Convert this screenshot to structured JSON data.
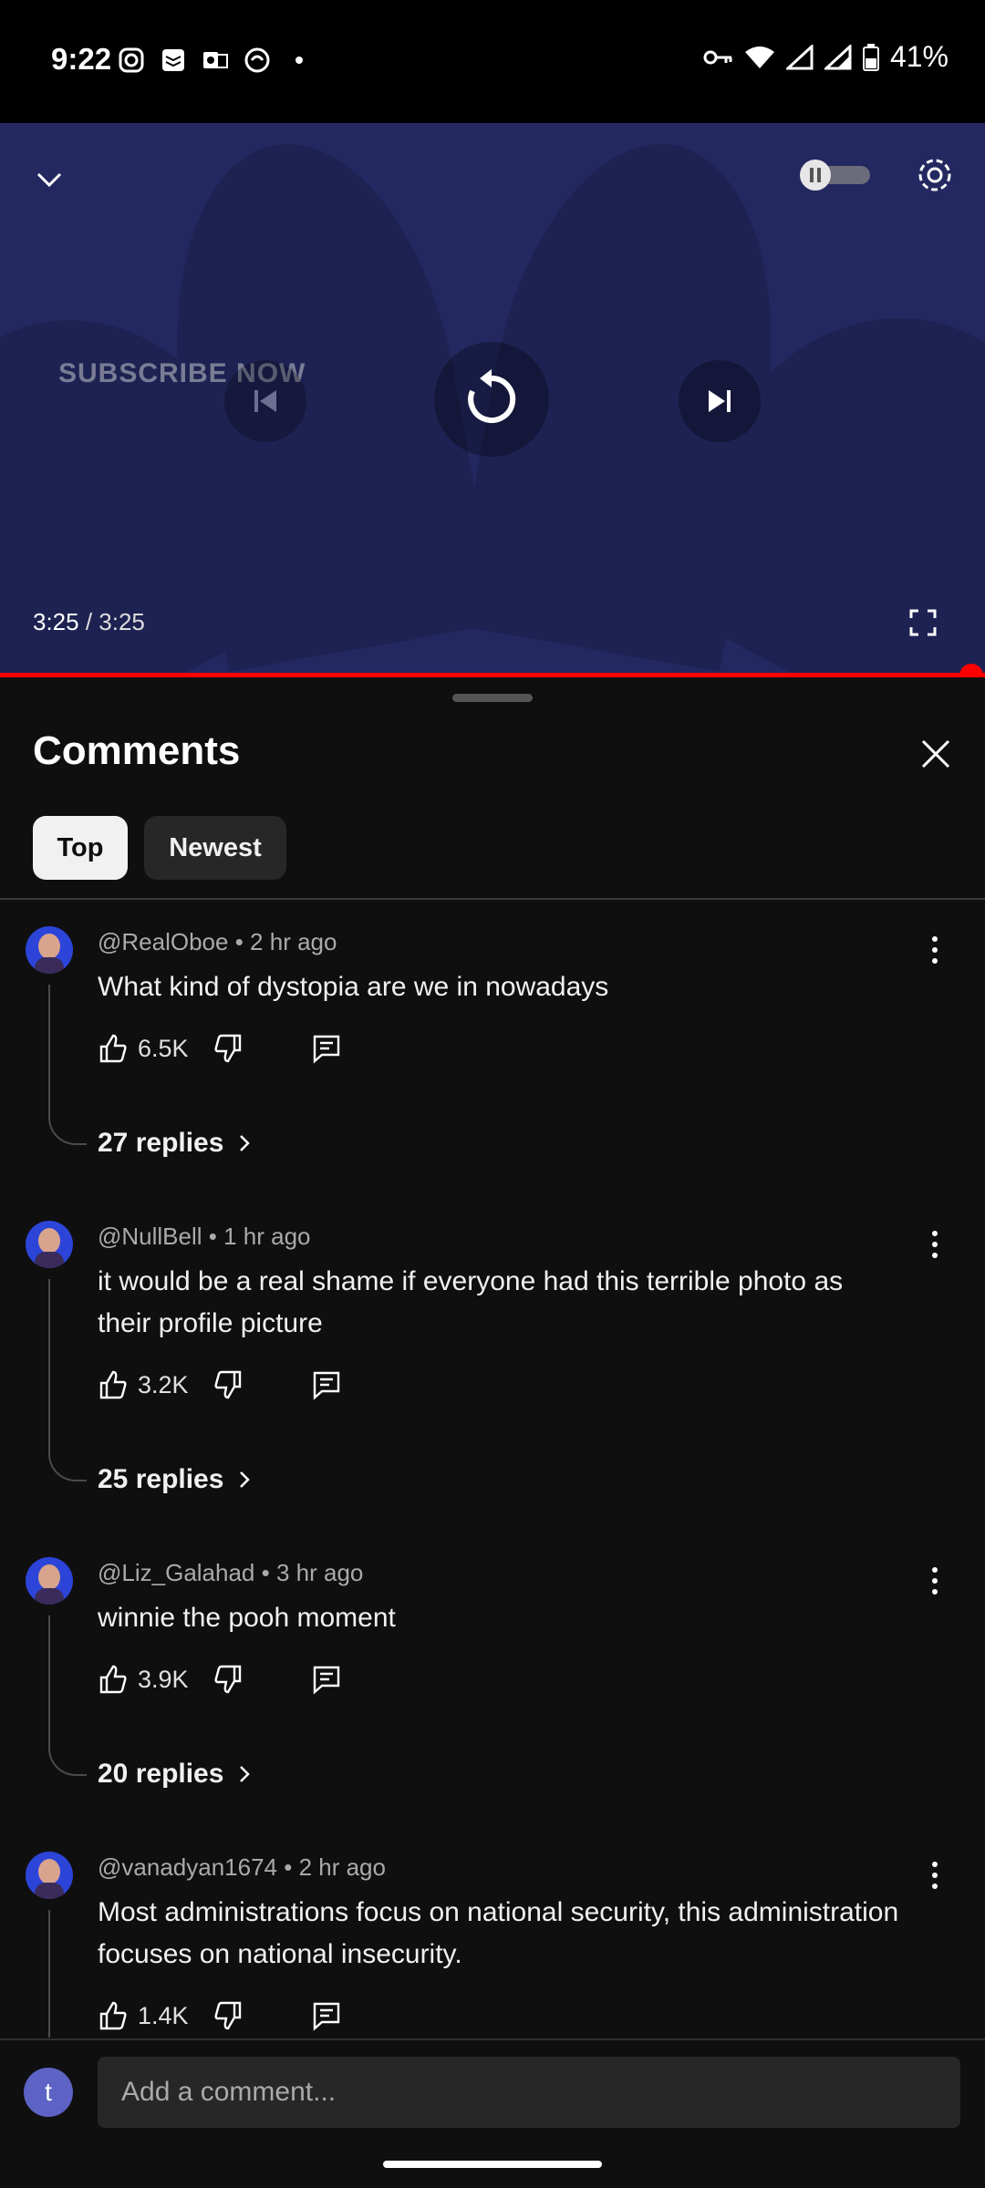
{
  "status_bar": {
    "time": "9:22",
    "battery": "41%"
  },
  "player": {
    "overlay_text": "SUBSCRIBE NOW",
    "current_time": "3:25",
    "separator": " / ",
    "duration": "3:25",
    "progress": 1.0,
    "accent_color": "#ff0000"
  },
  "comments_panel": {
    "title": "Comments",
    "filters": {
      "top": "Top",
      "newest": "Newest",
      "selected": "Top"
    },
    "comments": [
      {
        "author": "@RealOboe",
        "time": "2 hr ago",
        "text": "What kind of dystopia are we in nowadays",
        "likes": "6.5K",
        "replies": "27 replies"
      },
      {
        "author": "@NullBell",
        "time": "1 hr ago",
        "text": "it would be a real shame if everyone had this terrible photo as their profile picture",
        "likes": "3.2K",
        "replies": "25 replies"
      },
      {
        "author": "@Liz_Galahad",
        "time": "3 hr ago",
        "text": "winnie the pooh moment",
        "likes": "3.9K",
        "replies": "20 replies"
      },
      {
        "author": "@vanadyan1674",
        "time": "2 hr ago",
        "text": "Most administrations focus on national security, this administration focuses on national insecurity.",
        "likes": "1.4K"
      }
    ],
    "meta_separator": " • ",
    "add_comment": {
      "avatar_letter": "t",
      "placeholder": "Add a comment..."
    }
  }
}
